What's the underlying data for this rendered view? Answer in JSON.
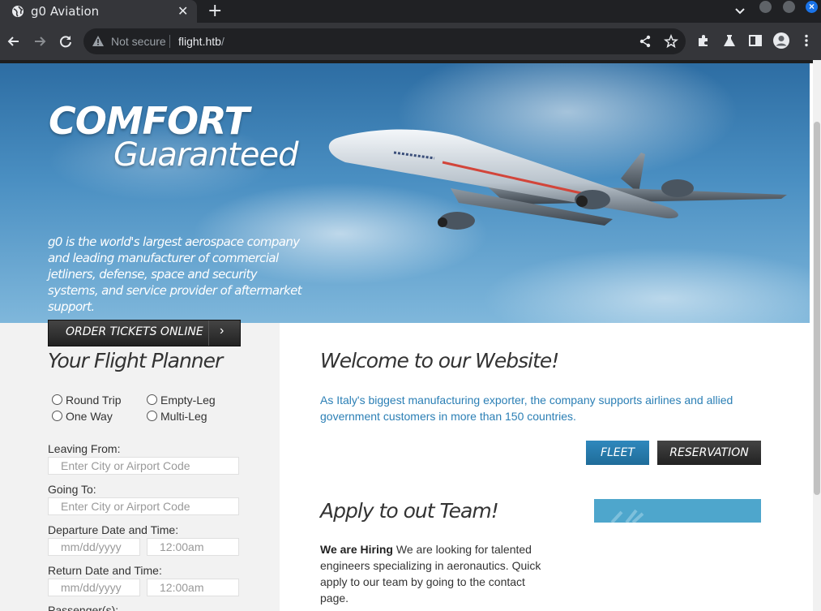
{
  "browser": {
    "tab_title": "g0 Aviation",
    "tab_close": "✕",
    "new_tab": "+",
    "security_label": "Not secure",
    "url_host": "flight.htb",
    "url_path": "/"
  },
  "hero": {
    "headline": "COMFORT",
    "subheadline": "Guaranteed",
    "description": "g0 is the world's largest aerospace company and leading manufacturer of commercial jetliners, defense, space and security systems, and service provider of aftermarket support."
  },
  "sidebar": {
    "order_button": "ORDER TICKETS ONLINE",
    "order_arrow": "›",
    "planner_title": "Your Flight Planner",
    "trip_types": [
      "Round Trip",
      "Empty-Leg",
      "One Way",
      "Multi-Leg"
    ],
    "leaving_label": "Leaving From:",
    "leaving_placeholder": "Enter City or Airport Code",
    "going_label": "Going To:",
    "going_placeholder": "Enter City or Airport Code",
    "departure_label": "Departure Date and Time:",
    "return_label": "Return Date and Time:",
    "date_placeholder": "mm/dd/yyyy",
    "time_placeholder": "12:00am",
    "passengers_label": "Passenger(s):"
  },
  "main": {
    "welcome_title": "Welcome to our Website!",
    "welcome_text": "As Italy's biggest manufacturing exporter, the company supports airlines and allied government customers in more than 150 countries.",
    "fleet_button": "FLEET",
    "reservation_button": "RESERVATION",
    "apply_title": "Apply to out Team!",
    "hiring_bold": "We are Hiring",
    "hiring_text": " We are looking for talented engineers specializing in aeronautics. Quick apply to our team by going to the contact page."
  },
  "colors": {
    "link_blue": "#2b7fb5",
    "fleet_button": "#2f88bd",
    "dark_button": "#333333",
    "sidebar_bg": "#f2f2f2"
  },
  "icons": [
    "globe-icon",
    "close-icon",
    "plus-icon",
    "chevron-down-icon",
    "back-arrow-icon",
    "forward-arrow-icon",
    "reload-icon",
    "warning-icon",
    "share-icon",
    "star-icon",
    "puzzle-icon",
    "flask-icon",
    "sidepanel-icon",
    "profile-icon",
    "menu-dots-icon"
  ]
}
